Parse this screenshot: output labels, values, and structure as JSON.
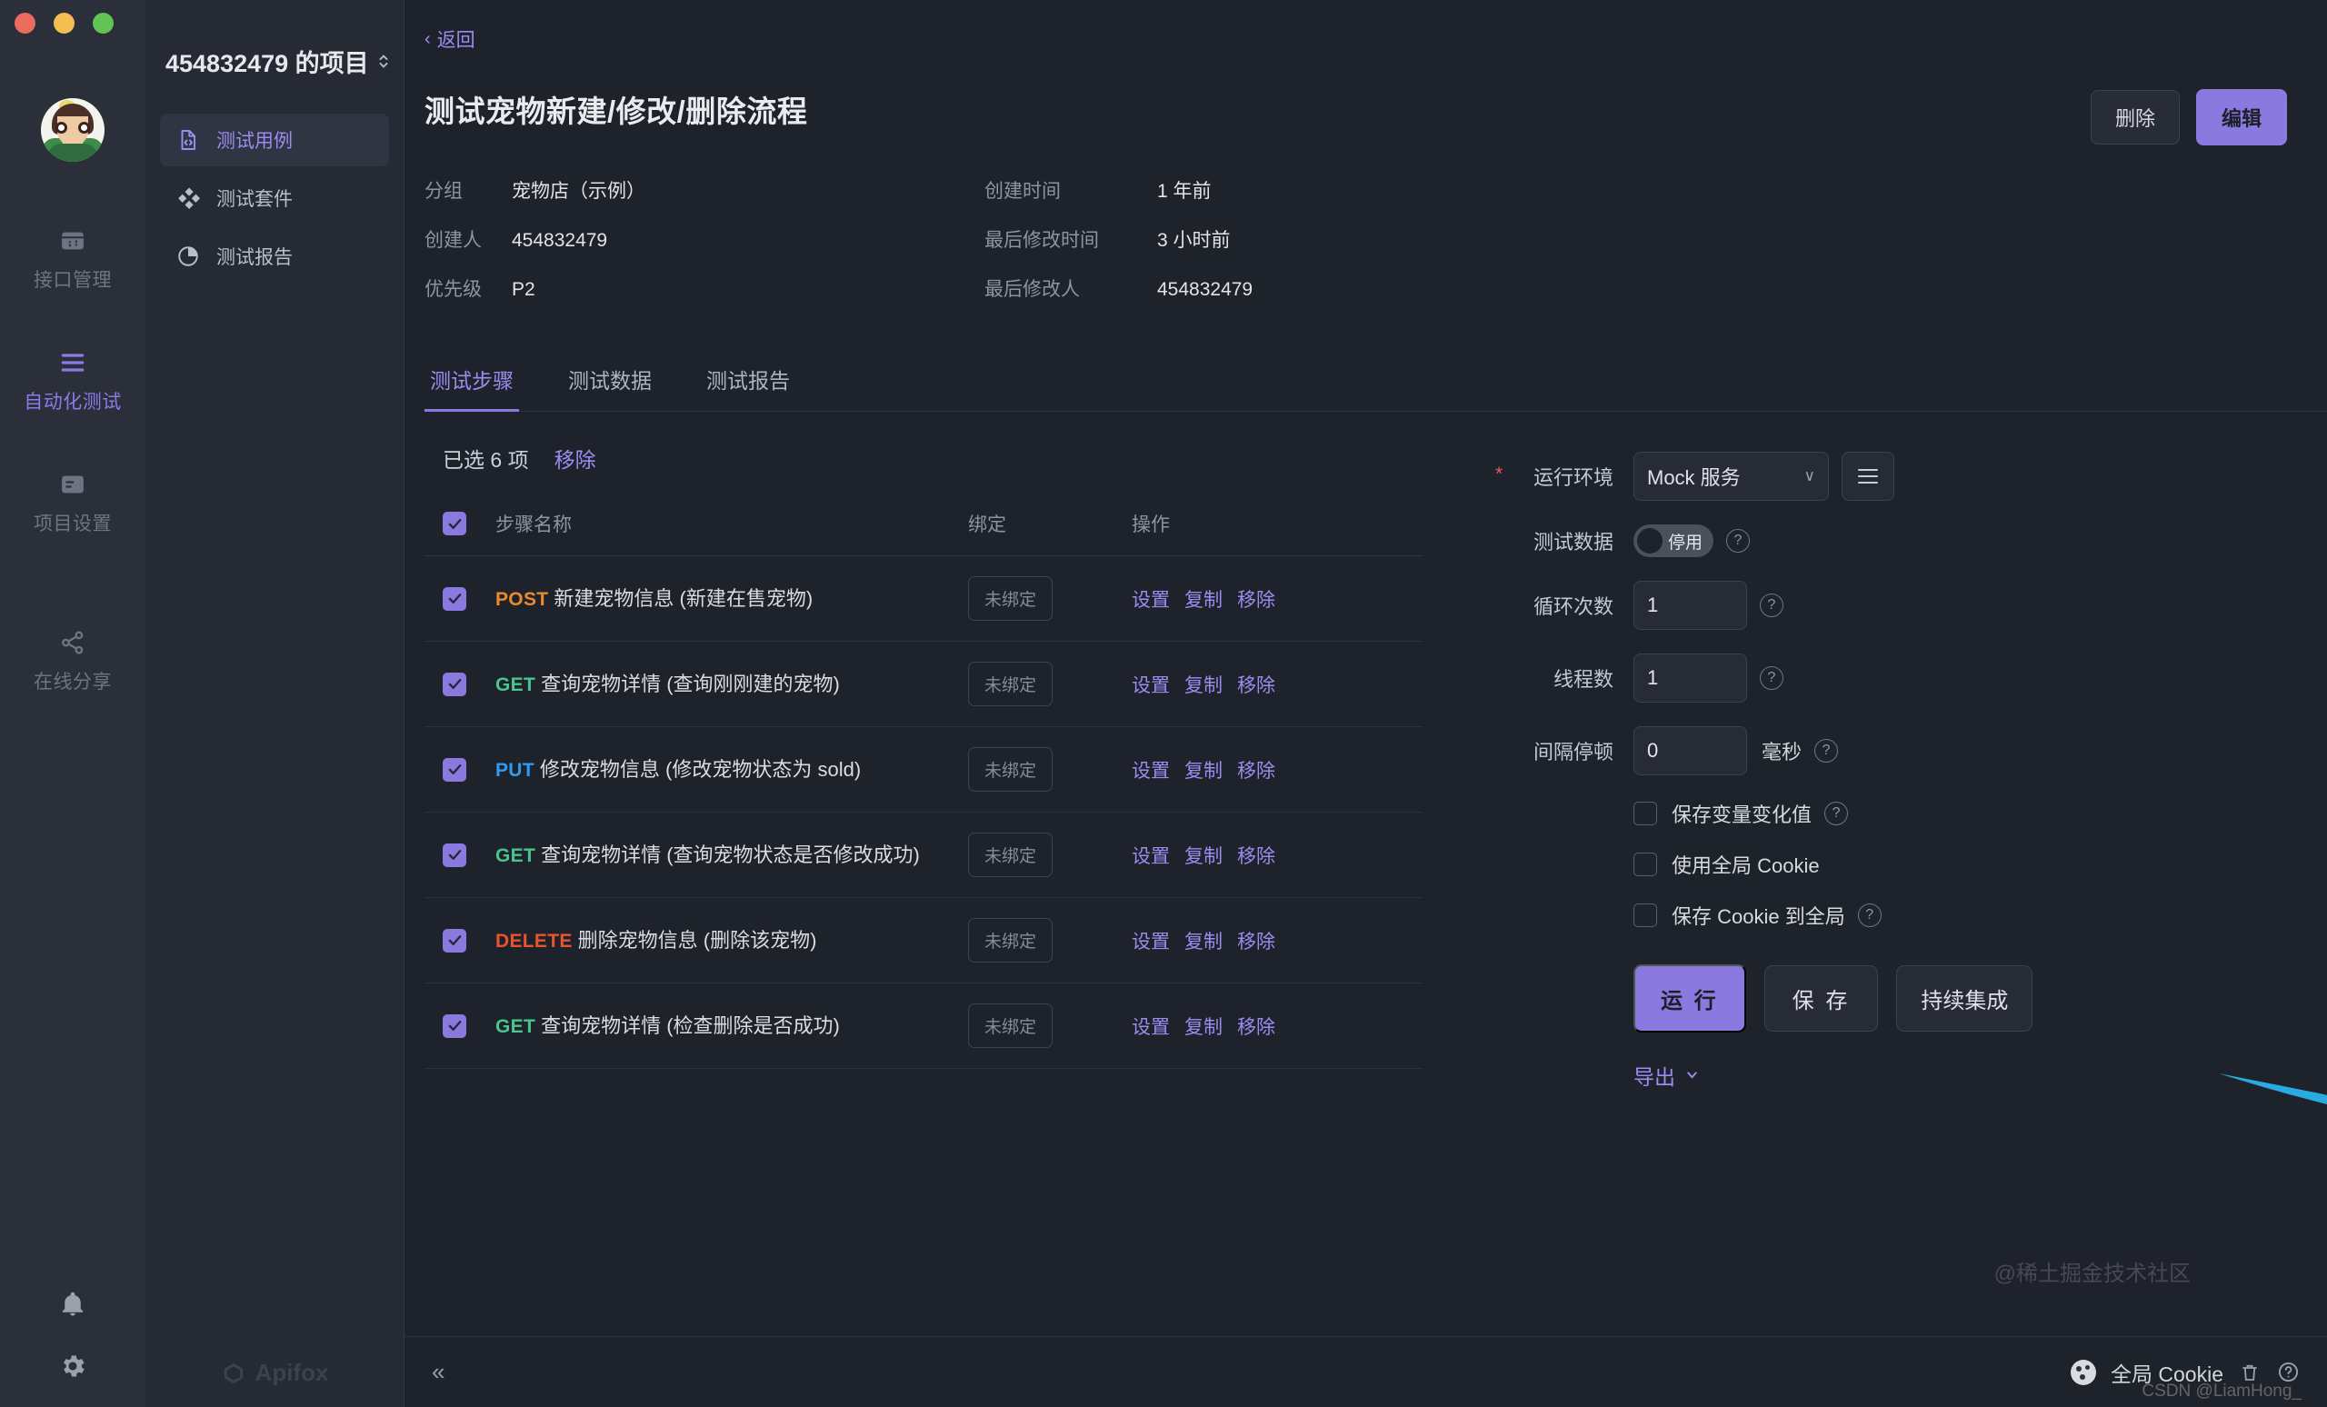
{
  "window": {
    "traffic_lights": [
      "close",
      "minimize",
      "zoom"
    ]
  },
  "rail": {
    "avatar_name": "user-avatar",
    "items": [
      {
        "label": "接口管理",
        "icon": "api-panel-icon",
        "active": false
      },
      {
        "label": "自动化测试",
        "icon": "automation-test-icon",
        "active": true
      },
      {
        "label": "项目设置",
        "icon": "project-settings-icon",
        "active": false
      },
      {
        "label": "在线分享",
        "icon": "share-icon",
        "active": false
      }
    ],
    "bottom_icons": [
      "bell-icon",
      "gear-icon"
    ]
  },
  "project_panel": {
    "title": "454832479 的项目",
    "switcher_icon": "up-down-chevron-icon",
    "nav": [
      {
        "label": "测试用例",
        "icon": "test-case-file-icon",
        "active": true
      },
      {
        "label": "测试套件",
        "icon": "test-suite-diamond-icon",
        "active": false
      },
      {
        "label": "测试报告",
        "icon": "test-report-pie-icon",
        "active": false
      }
    ],
    "brand": "Apifox"
  },
  "main": {
    "back_label": "返回",
    "case_title": "测试宠物新建/修改/删除流程",
    "actions": {
      "delete": "删除",
      "edit": "编辑"
    },
    "meta": [
      {
        "key": "分组",
        "value": "宠物店（示例）"
      },
      {
        "key": "创建时间",
        "value": "1 年前"
      },
      {
        "key": "创建人",
        "value": "454832479"
      },
      {
        "key": "最后修改时间",
        "value": "3 小时前"
      },
      {
        "key": "优先级",
        "value": "P2"
      },
      {
        "key": "最后修改人",
        "value": "454832479"
      }
    ],
    "meta_left": [
      {
        "key": "分组",
        "value": "宠物店（示例）"
      },
      {
        "key": "创建人",
        "value": "454832479"
      },
      {
        "key": "优先级",
        "value": "P2"
      }
    ],
    "meta_right": [
      {
        "key": "创建时间",
        "value": "1 年前"
      },
      {
        "key": "最后修改时间",
        "value": "3 小时前"
      },
      {
        "key": "最后修改人",
        "value": "454832479"
      }
    ],
    "tabs": [
      {
        "label": "测试步骤",
        "active": true
      },
      {
        "label": "测试数据",
        "active": false
      },
      {
        "label": "测试报告",
        "active": false
      }
    ],
    "selection": {
      "count_label": "已选 6 项",
      "remove_label": "移除"
    },
    "table": {
      "headers": {
        "name": "步骤名称",
        "bind": "绑定",
        "ops": "操作"
      },
      "header_checked": true,
      "ops_labels": [
        "设置",
        "复制",
        "移除"
      ],
      "bind_label": "未绑定",
      "rows": [
        {
          "checked": true,
          "method": "POST",
          "method_class": "post",
          "name": "新建宠物信息 (新建在售宠物)"
        },
        {
          "checked": true,
          "method": "GET",
          "method_class": "get",
          "name": "查询宠物详情 (查询刚刚建的宠物)"
        },
        {
          "checked": true,
          "method": "PUT",
          "method_class": "put",
          "name": "修改宠物信息 (修改宠物状态为 sold)"
        },
        {
          "checked": true,
          "method": "GET",
          "method_class": "get",
          "name": "查询宠物详情 (查询宠物状态是否修改成功)"
        },
        {
          "checked": true,
          "method": "DELETE",
          "method_class": "delete",
          "name": "删除宠物信息 (删除该宠物)"
        },
        {
          "checked": true,
          "method": "GET",
          "method_class": "get",
          "name": "查询宠物详情 (检查删除是否成功)"
        }
      ]
    }
  },
  "config": {
    "env": {
      "label": "运行环境",
      "required": true,
      "value": "Mock 服务",
      "menu_icon": "hamburger-icon"
    },
    "test_data": {
      "label": "测试数据",
      "switch_text": "停用",
      "enabled": false,
      "help": "?"
    },
    "loop_count": {
      "label": "循环次数",
      "value": "1",
      "help": "?"
    },
    "thread_count": {
      "label": "线程数",
      "value": "1",
      "help": "?"
    },
    "interval": {
      "label": "间隔停顿",
      "value": "0",
      "unit": "毫秒",
      "help": "?"
    },
    "checkboxes": [
      {
        "label": "保存变量变化值",
        "checked": false,
        "has_help": true
      },
      {
        "label": "使用全局 Cookie",
        "checked": false,
        "has_help": false
      },
      {
        "label": "保存 Cookie 到全局",
        "checked": false,
        "has_help": true
      }
    ],
    "buttons": {
      "run": "运 行",
      "save": "保 存",
      "ci": "持续集成"
    },
    "export": {
      "label": "导出",
      "chevron": "chevron-down-icon"
    }
  },
  "footer": {
    "collapse_icon": "collapse-left-icon",
    "cookie_label": "全局 Cookie",
    "icons": [
      "trash-icon",
      "help-circle-icon"
    ]
  },
  "watermarks": {
    "primary": "@稀土掘金技术社区",
    "secondary": "CSDN @LiamHong_"
  },
  "annotation": {
    "arrow": "blue-arrow-pointing-to-ci-button",
    "color": "#29ABE2"
  },
  "colors": {
    "accent": "#8a7ae0",
    "bg": "#1e222b",
    "panel": "#252a34",
    "rail": "#2a2f3a",
    "method_post": "#e88a2d",
    "method_get": "#49c48c",
    "method_put": "#2f9bf2",
    "method_delete": "#e8542b"
  }
}
